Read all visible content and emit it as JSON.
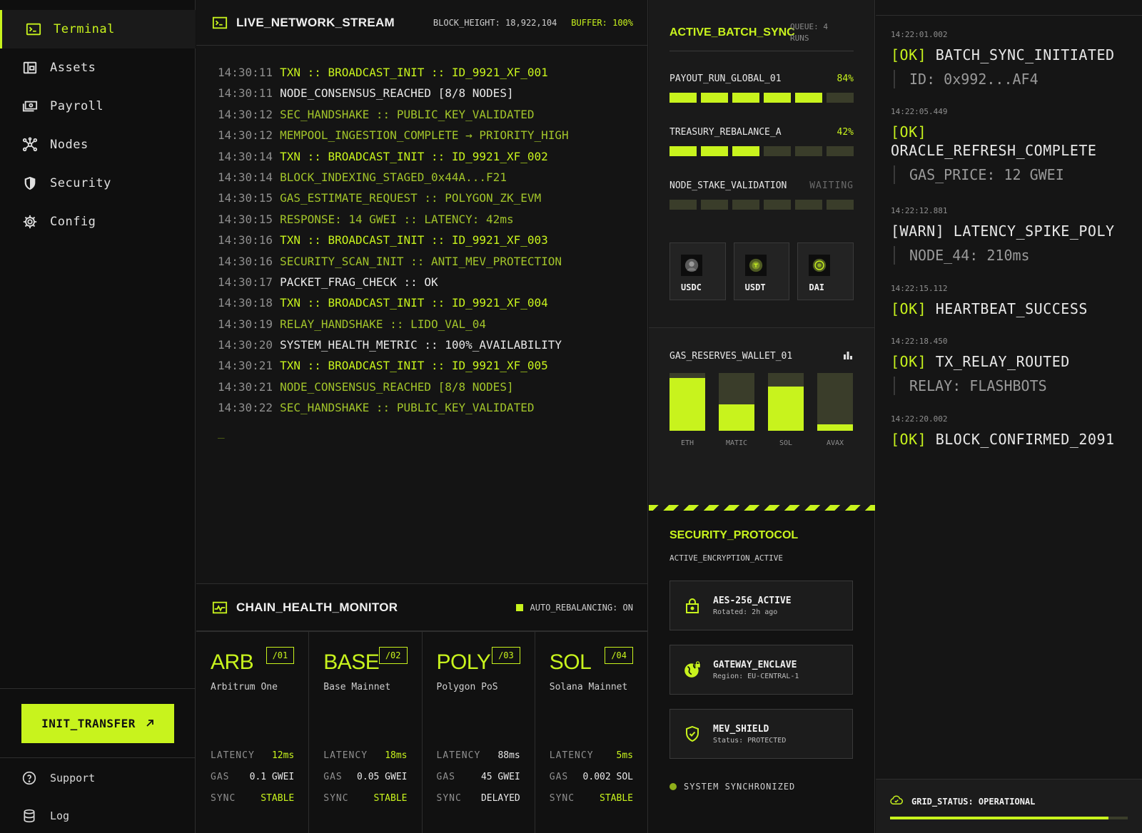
{
  "sidebar": {
    "items": [
      {
        "label": "Terminal",
        "icon": "terminal-icon",
        "active": true
      },
      {
        "label": "Assets",
        "icon": "wallet-icon"
      },
      {
        "label": "Payroll",
        "icon": "cash-icon"
      },
      {
        "label": "Nodes",
        "icon": "network-icon"
      },
      {
        "label": "Security",
        "icon": "shield-icon"
      },
      {
        "label": "Config",
        "icon": "gear-icon"
      }
    ],
    "cta_label": "INIT_TRANSFER",
    "footer": [
      {
        "label": "Support",
        "icon": "help-icon"
      },
      {
        "label": "Log",
        "icon": "database-icon"
      }
    ]
  },
  "stream": {
    "title": "LIVE_NETWORK_STREAM",
    "block_height": "BLOCK_HEIGHT: 18,922,104",
    "buffer": "BUFFER: 100%",
    "lines": [
      {
        "ts": "14:30:11",
        "msg": "TXN :: BROADCAST_INIT :: ID_9921_XF_001",
        "kind": "txn"
      },
      {
        "ts": "14:30:11",
        "msg": "NODE_CONSENSUS_REACHED [8/8 NODES]",
        "kind": "white"
      },
      {
        "ts": "14:30:12",
        "msg": "SEC_HANDSHAKE :: PUBLIC_KEY_VALIDATED",
        "kind": "dim"
      },
      {
        "ts": "14:30:12",
        "msg": "MEMPOOL_INGESTION_COMPLETE → PRIORITY_HIGH",
        "kind": "dim"
      },
      {
        "ts": "14:30:14",
        "msg": "TXN :: BROADCAST_INIT :: ID_9921_XF_002",
        "kind": "txn"
      },
      {
        "ts": "14:30:14",
        "msg": "BLOCK_INDEXING_STAGED_0x44A...F21",
        "kind": "dim"
      },
      {
        "ts": "14:30:15",
        "msg": "GAS_ESTIMATE_REQUEST :: POLYGON_ZK_EVM",
        "kind": "dim"
      },
      {
        "ts": "14:30:15",
        "msg": "RESPONSE: 14 GWEI :: LATENCY: 42ms",
        "kind": "dim"
      },
      {
        "ts": "14:30:16",
        "msg": "TXN :: BROADCAST_INIT :: ID_9921_XF_003",
        "kind": "txn"
      },
      {
        "ts": "14:30:16",
        "msg": "SECURITY_SCAN_INIT :: ANTI_MEV_PROTECTION",
        "kind": "dim"
      },
      {
        "ts": "14:30:17",
        "msg": "PACKET_FRAG_CHECK :: OK",
        "kind": "white"
      },
      {
        "ts": "14:30:18",
        "msg": "TXN :: BROADCAST_INIT :: ID_9921_XF_004",
        "kind": "txn"
      },
      {
        "ts": "14:30:19",
        "msg": "RELAY_HANDSHAKE :: LIDO_VAL_04",
        "kind": "dim"
      },
      {
        "ts": "14:30:20",
        "msg": "SYSTEM_HEALTH_METRIC :: 100%_AVAILABILITY",
        "kind": "white"
      },
      {
        "ts": "14:30:21",
        "msg": "TXN :: BROADCAST_INIT :: ID_9921_XF_005",
        "kind": "txn"
      },
      {
        "ts": "14:30:21",
        "msg": "NODE_CONSENSUS_REACHED [8/8 NODES]",
        "kind": "dim"
      },
      {
        "ts": "14:30:22",
        "msg": "SEC_HANDSHAKE :: PUBLIC_KEY_VALIDATED",
        "kind": "dim"
      }
    ],
    "cursor": "_"
  },
  "chain_health": {
    "title": "CHAIN_HEALTH_MONITOR",
    "auto_rebalancing": "AUTO_REBALANCING: ON",
    "labels": {
      "latency": "LATENCY",
      "gas": "GAS",
      "sync": "SYNC"
    },
    "chains": [
      {
        "sym": "ARB",
        "idx": "/01",
        "name": "Arbitrum One",
        "latency": "12ms",
        "gas": "0.1 GWEI",
        "sync": "STABLE",
        "latency_hl": true,
        "sync_hl": true
      },
      {
        "sym": "BASE",
        "idx": "/02",
        "name": "Base Mainnet",
        "latency": "18ms",
        "gas": "0.05 GWEI",
        "sync": "STABLE",
        "latency_hl": true,
        "sync_hl": true
      },
      {
        "sym": "POLY",
        "idx": "/03",
        "name": "Polygon PoS",
        "latency": "88ms",
        "gas": "45 GWEI",
        "sync": "DELAYED",
        "latency_hl": false,
        "sync_hl": false
      },
      {
        "sym": "SOL",
        "idx": "/04",
        "name": "Solana Mainnet",
        "latency": "5ms",
        "gas": "0.002 SOL",
        "sync": "STABLE",
        "latency_hl": true,
        "sync_hl": true
      }
    ]
  },
  "batch_sync": {
    "title": "ACTIVE_BATCH_SYNC",
    "queue": "QUEUE: 4 RUNS",
    "runs": [
      {
        "name": "PAYOUT_RUN_GLOBAL_01",
        "status": "84%",
        "progress": 0.84,
        "waiting": false
      },
      {
        "name": "TREASURY_REBALANCE_A",
        "status": "42%",
        "progress": 0.42,
        "waiting": false
      },
      {
        "name": "NODE_STAKE_VALIDATION",
        "status": "WAITING",
        "progress": 0,
        "waiting": true
      }
    ],
    "assets": [
      {
        "label": "USDC",
        "icon": "usdc-coin-icon"
      },
      {
        "label": "USDT",
        "icon": "usdt-coin-icon"
      },
      {
        "label": "DAI",
        "icon": "dai-coin-icon"
      }
    ]
  },
  "gas_reserves": {
    "title": "GAS_RESERVES_WALLET_01",
    "bars": [
      {
        "label": "ETH",
        "level": 0.91
      },
      {
        "label": "MATIC",
        "level": 0.46
      },
      {
        "label": "SOL",
        "level": 0.76
      },
      {
        "label": "AVAX",
        "level": 0.11
      }
    ]
  },
  "security": {
    "title": "SECURITY_PROTOCOL",
    "subtitle": "ACTIVE_ENCRYPTION_ACTIVE",
    "cards": [
      {
        "name": "AES-256_ACTIVE",
        "sub": "Rotated: 2h ago",
        "icon": "lock-icon"
      },
      {
        "name": "GATEWAY_ENCLAVE",
        "sub": "Region: EU-CENTRAL-1",
        "icon": "globe-lock-icon"
      },
      {
        "name": "MEV_SHIELD",
        "sub": "Status: PROTECTED",
        "icon": "shield-check-icon"
      }
    ],
    "status": "SYSTEM SYNCHRONIZED"
  },
  "events": {
    "items": [
      {
        "ts": "14:22:01.002",
        "tag": "[OK]",
        "msg": "BATCH_SYNC_INITIATED",
        "detail": "ID: 0x992...AF4"
      },
      {
        "ts": "14:22:05.449",
        "tag": "[OK]",
        "msg": "ORACLE_REFRESH_COMPLETE",
        "detail": "GAS_PRICE: 12 GWEI"
      },
      {
        "ts": "14:22:12.881",
        "tag": "[WARN]",
        "msg": "LATENCY_SPIKE_POLY",
        "detail": "NODE_44: 210ms"
      },
      {
        "ts": "14:22:15.112",
        "tag": "[OK]",
        "msg": "HEARTBEAT_SUCCESS",
        "detail": ""
      },
      {
        "ts": "14:22:18.450",
        "tag": "[OK]",
        "msg": "TX_RELAY_ROUTED",
        "detail": "RELAY: FLASHBOTS"
      },
      {
        "ts": "14:22:20.002",
        "tag": "[OK]",
        "msg": "BLOCK_CONFIRMED_2091",
        "detail": ""
      }
    ],
    "grid_status": "GRID_STATUS: OPERATIONAL",
    "grid_progress": 0.92
  },
  "colors": {
    "accent": "#c8f31d",
    "bg": "#111111",
    "panel": "#1a1a1a",
    "muted": "#3a3d2a"
  }
}
